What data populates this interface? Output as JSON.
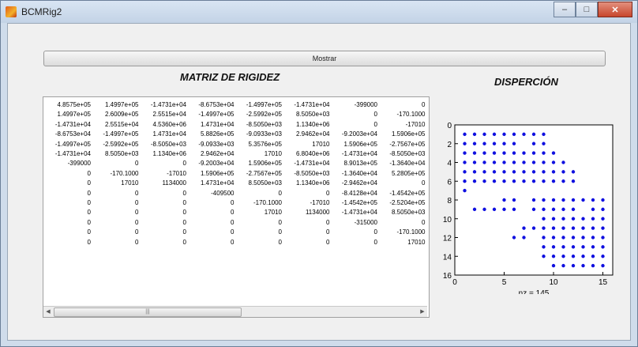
{
  "window": {
    "title": "BCMRig2",
    "controls": {
      "minimize": "–",
      "maximize": "□",
      "close": "✕"
    }
  },
  "toolbar": {
    "mostrar_label": "Mostrar"
  },
  "headings": {
    "matrix": "MATRIZ DE RIGIDEZ",
    "dispersion": "DISPERCIÓN"
  },
  "table": {
    "rows": [
      [
        "4.8575e+05",
        "1.4997e+05",
        "-1.4731e+04",
        "-8.6753e+04",
        "-1.4997e+05",
        "-1.4731e+04",
        "-399000",
        "0"
      ],
      [
        "1.4997e+05",
        "2.6009e+05",
        "2.5515e+04",
        "-1.4997e+05",
        "-2.5992e+05",
        "8.5050e+03",
        "0",
        "-170.1000"
      ],
      [
        "-1.4731e+04",
        "2.5515e+04",
        "4.5360e+06",
        "1.4731e+04",
        "-8.5050e+03",
        "1.1340e+06",
        "0",
        "-17010"
      ],
      [
        "-8.6753e+04",
        "-1.4997e+05",
        "1.4731e+04",
        "5.8826e+05",
        "-9.0933e+03",
        "2.9462e+04",
        "-9.2003e+04",
        "1.5906e+05"
      ],
      [
        "-1.4997e+05",
        "-2.5992e+05",
        "-8.5050e+03",
        "-9.0933e+03",
        "5.3576e+05",
        "17010",
        "1.5906e+05",
        "-2.7567e+05"
      ],
      [
        "-1.4731e+04",
        "8.5050e+03",
        "1.1340e+06",
        "2.9462e+04",
        "17010",
        "6.8040e+06",
        "-1.4731e+04",
        "-8.5050e+03"
      ],
      [
        "-399000",
        "0",
        "0",
        "-9.2003e+04",
        "1.5906e+05",
        "-1.4731e+04",
        "8.9013e+05",
        "-1.3640e+04"
      ],
      [
        "0",
        "-170.1000",
        "-17010",
        "1.5906e+05",
        "-2.7567e+05",
        "-8.5050e+03",
        "-1.3640e+04",
        "5.2805e+05"
      ],
      [
        "0",
        "17010",
        "1134000",
        "1.4731e+04",
        "8.5050e+03",
        "1.1340e+06",
        "-2.9462e+04",
        "0"
      ],
      [
        "0",
        "0",
        "0",
        "-409500",
        "0",
        "0",
        "-8.4128e+04",
        "-1.4542e+05"
      ],
      [
        "0",
        "0",
        "0",
        "0",
        "-170.1000",
        "-17010",
        "-1.4542e+05",
        "-2.5204e+05"
      ],
      [
        "0",
        "0",
        "0",
        "0",
        "17010",
        "1134000",
        "-1.4731e+04",
        "8.5050e+03"
      ],
      [
        "0",
        "0",
        "0",
        "0",
        "0",
        "0",
        "-315000",
        "0"
      ],
      [
        "0",
        "0",
        "0",
        "0",
        "0",
        "0",
        "0",
        "-170.1000"
      ],
      [
        "0",
        "0",
        "0",
        "0",
        "0",
        "0",
        "0",
        "17010"
      ]
    ],
    "scroll_left": "◀",
    "scroll_right": "▶",
    "scroll_grip": "|||"
  },
  "spy_plot": {
    "marker_color": "#1010e0",
    "x_ticks": [
      "0",
      "5",
      "10",
      "15"
    ],
    "y_ticks": [
      "0",
      "2",
      "4",
      "6",
      "8",
      "10",
      "12",
      "14",
      "16"
    ],
    "xlabel": "nz = 145",
    "pattern": [
      "111111111000000",
      "111111011000000",
      "111111111100000",
      "111111111110000",
      "111111111111000",
      "111111111111000",
      "100000000000000",
      "000011011111111",
      "011111011111011",
      "000000001111111",
      "000000111111111",
      "000001101111111",
      "000000001111111",
      "000000001111111",
      "000000000111111"
    ]
  }
}
